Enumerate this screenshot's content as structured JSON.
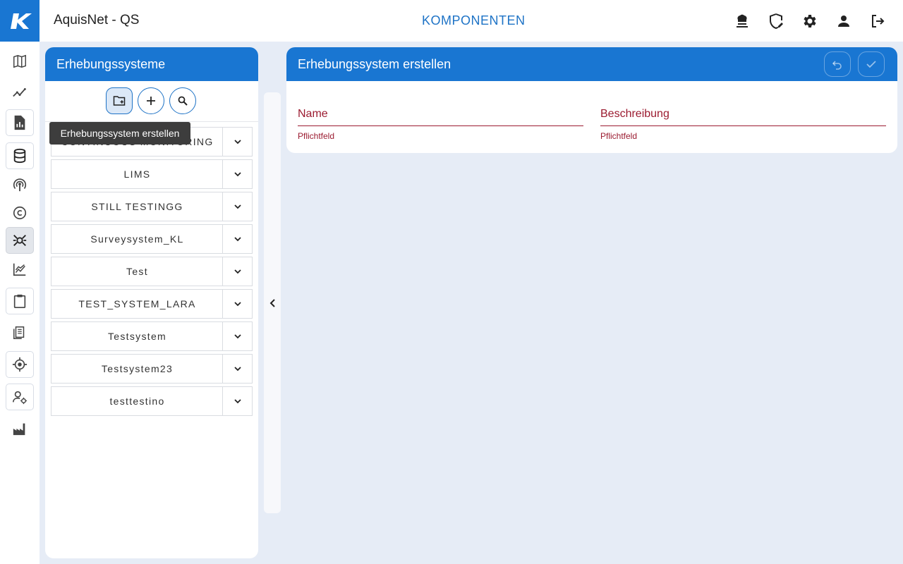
{
  "app": {
    "title": "AquisNet - QS",
    "page_title": "KOMPONENTEN",
    "accent": "#1976d2",
    "error_color": "#9b1b30"
  },
  "topbar_icons": [
    "chef-hat-icon",
    "shield-edit-icon",
    "gear-icon",
    "person-icon",
    "logout-icon"
  ],
  "sidebar_icons": [
    "map-icon",
    "trend-chart-icon",
    "report-icon",
    "database-icon",
    "antenna-icon",
    "copyright-icon",
    "bug-icon",
    "line-chart-icon",
    "clipboard-icon",
    "document-stack-icon",
    "target-icon",
    "user-settings-icon",
    "factory-icon"
  ],
  "left_panel": {
    "title": "Erhebungssysteme",
    "tooltip": "Erhebungssystem erstellen",
    "items": [
      {
        "label": "CONTINUOUS MONITORING"
      },
      {
        "label": "LIMS"
      },
      {
        "label": "STILL TESTINGG"
      },
      {
        "label": "Surveysystem_KL"
      },
      {
        "label": "Test"
      },
      {
        "label": "TEST_SYSTEM_LARA"
      },
      {
        "label": "Testsystem"
      },
      {
        "label": "Testsystem23"
      },
      {
        "label": "testtestino"
      }
    ]
  },
  "form": {
    "title": "Erhebungssystem erstellen",
    "name_label": "Name",
    "name_hint": "Pflichtfeld",
    "description_label": "Beschreibung",
    "description_hint": "Pflichtfeld"
  }
}
